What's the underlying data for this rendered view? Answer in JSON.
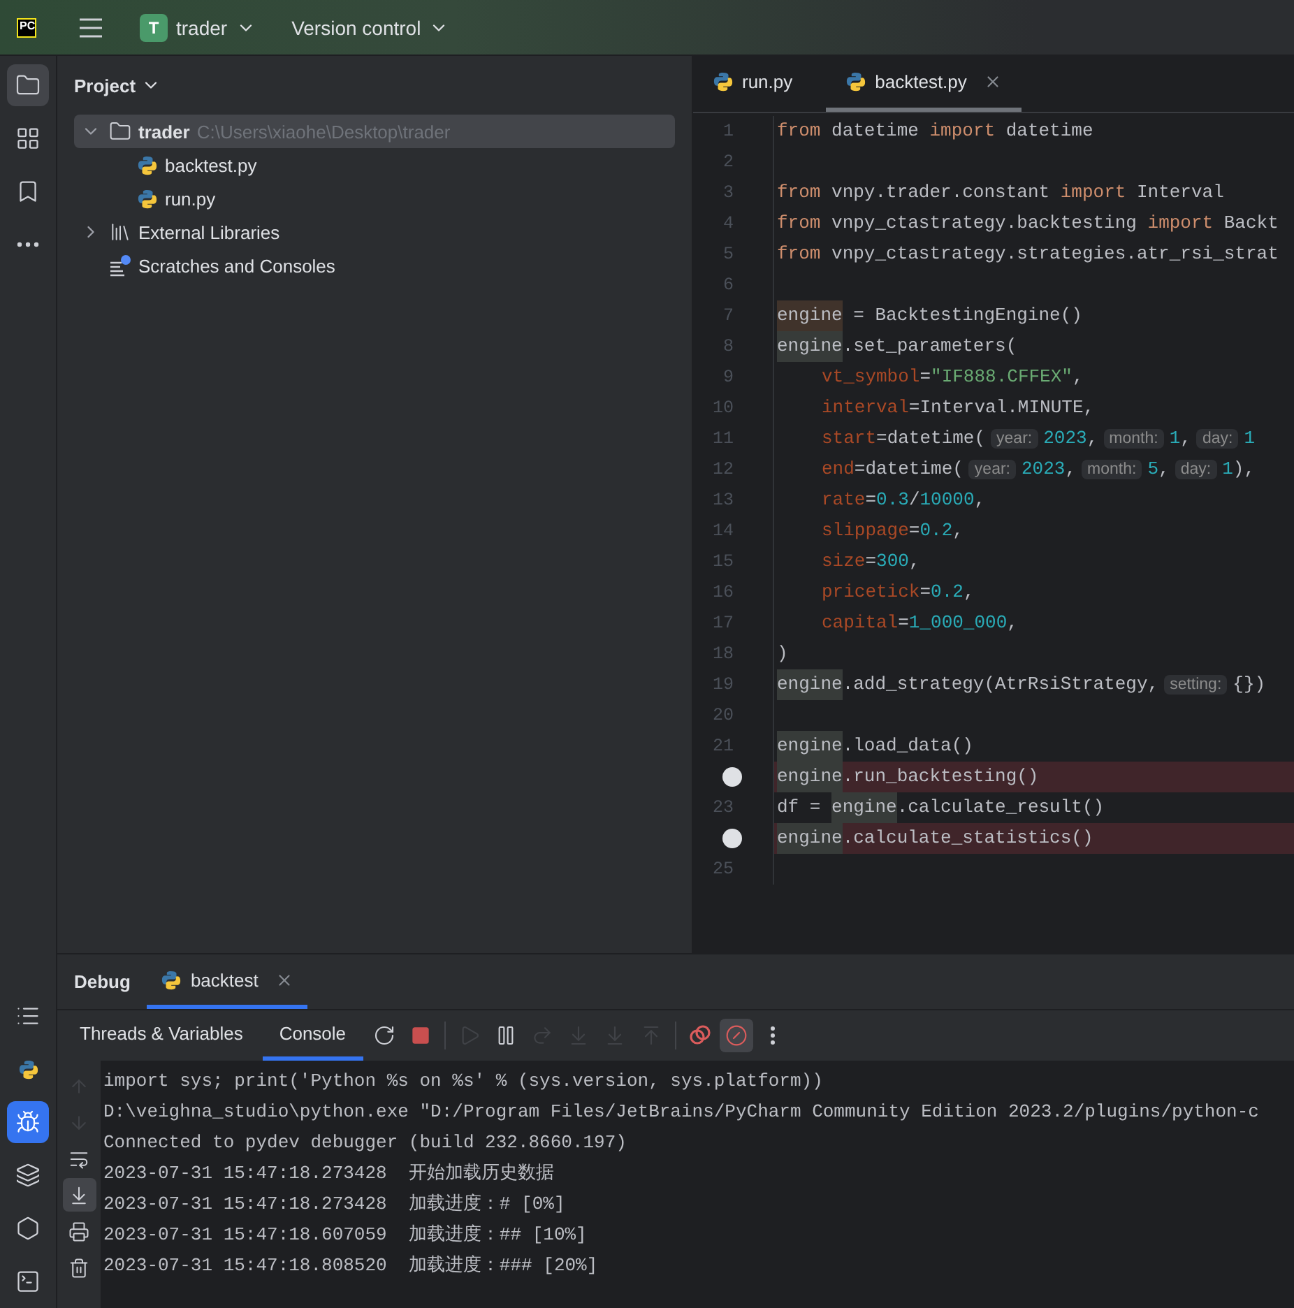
{
  "title_bar": {
    "logo": "PC",
    "project_badge": "T",
    "project": "trader",
    "vcs": "Version control"
  },
  "tool_strip": {
    "top": [
      {
        "kind": "project",
        "selected": true
      },
      {
        "kind": "structure",
        "selected": false
      },
      {
        "kind": "bookmarks",
        "selected": false
      },
      {
        "kind": "more",
        "selected": false
      }
    ],
    "bottom": [
      {
        "kind": "services",
        "selected": false
      },
      {
        "kind": "python_console",
        "selected": false
      },
      {
        "kind": "debug",
        "selected": true
      },
      {
        "kind": "packages",
        "selected": false
      },
      {
        "kind": "run",
        "selected": false
      },
      {
        "kind": "terminal",
        "selected": false
      }
    ]
  },
  "project_panel": {
    "title": "Project",
    "tree": [
      {
        "label": "trader",
        "path": "C:\\Users\\xiaohe\\Desktop\\trader",
        "kind": "folder",
        "expanded": true,
        "selected": true,
        "children": [
          {
            "label": "backtest.py",
            "kind": "python",
            "selected": false
          },
          {
            "label": "run.py",
            "kind": "python",
            "selected": false
          }
        ]
      },
      {
        "label": "External Libraries",
        "kind": "libraries",
        "expanded": false,
        "selected": false
      },
      {
        "label": "Scratches and Consoles",
        "kind": "scratches",
        "selected": false
      }
    ]
  },
  "editor": {
    "tabs": [
      {
        "label": "run.py",
        "selected": false
      },
      {
        "label": "backtest.py",
        "selected": true
      }
    ],
    "lines": [
      {
        "number": "1",
        "breakpoint": false,
        "indented": false,
        "tokens": [
          {
            "kind": "kw",
            "text": "from"
          },
          {
            "kind": "plain",
            "text": " datetime "
          },
          {
            "kind": "kw",
            "text": "import"
          },
          {
            "kind": "plain",
            "text": " datetime"
          }
        ]
      },
      {
        "number": "2",
        "breakpoint": false
      },
      {
        "number": "3",
        "breakpoint": false,
        "indented": false,
        "tokens": [
          {
            "kind": "kw",
            "text": "from"
          },
          {
            "kind": "plain",
            "text": " vnpy.trader.constant "
          },
          {
            "kind": "kw",
            "text": "import"
          },
          {
            "kind": "plain",
            "text": " Interval"
          }
        ]
      },
      {
        "number": "4",
        "breakpoint": false,
        "indented": false,
        "tokens": [
          {
            "kind": "kw",
            "text": "from"
          },
          {
            "kind": "plain",
            "text": " vnpy_ctastrategy.backtesting "
          },
          {
            "kind": "kw",
            "text": "import"
          },
          {
            "kind": "plain",
            "text": " Backt"
          }
        ]
      },
      {
        "number": "5",
        "breakpoint": false,
        "indented": false,
        "tokens": [
          {
            "kind": "kw",
            "text": "from"
          },
          {
            "kind": "plain",
            "text": " vnpy_ctastrategy.strategies.atr_rsi_strat"
          }
        ]
      },
      {
        "number": "6",
        "breakpoint": false
      },
      {
        "number": "7",
        "breakpoint": false,
        "indented": false,
        "tokens": [
          {
            "kind": "write",
            "text": "engine"
          },
          {
            "kind": "plain",
            "text": " = BacktestingEngine()"
          }
        ]
      },
      {
        "number": "8",
        "breakpoint": false,
        "indented": false,
        "tokens": [
          {
            "kind": "read",
            "text": "engine"
          },
          {
            "kind": "plain",
            "text": ".set_parameters("
          }
        ]
      },
      {
        "number": "9",
        "breakpoint": false,
        "indented": true,
        "tokens": [
          {
            "kind": "param",
            "text": "vt_symbol"
          },
          {
            "kind": "plain",
            "text": "="
          },
          {
            "kind": "str",
            "text": "\"IF888.CFFEX\""
          },
          {
            "kind": "plain",
            "text": ","
          }
        ]
      },
      {
        "number": "10",
        "breakpoint": false,
        "indented": true,
        "tokens": [
          {
            "kind": "param",
            "text": "interval"
          },
          {
            "kind": "plain",
            "text": "=Interval.MINUTE,"
          }
        ]
      },
      {
        "number": "11",
        "breakpoint": false,
        "indented": true,
        "tokens": [
          {
            "kind": "param",
            "text": "start"
          },
          {
            "kind": "plain",
            "text": "=datetime("
          },
          {
            "kind": "hint",
            "text": "year:"
          },
          {
            "kind": "num",
            "text": "2023"
          },
          {
            "kind": "plain",
            "text": ","
          },
          {
            "kind": "hint",
            "text": "month:"
          },
          {
            "kind": "num",
            "text": "1"
          },
          {
            "kind": "plain",
            "text": ","
          },
          {
            "kind": "hint",
            "text": "day:"
          },
          {
            "kind": "num",
            "text": "1"
          }
        ]
      },
      {
        "number": "12",
        "breakpoint": false,
        "indented": true,
        "tokens": [
          {
            "kind": "param",
            "text": "end"
          },
          {
            "kind": "plain",
            "text": "=datetime("
          },
          {
            "kind": "hint",
            "text": "year:"
          },
          {
            "kind": "num",
            "text": "2023"
          },
          {
            "kind": "plain",
            "text": ","
          },
          {
            "kind": "hint",
            "text": "month:"
          },
          {
            "kind": "num",
            "text": "5"
          },
          {
            "kind": "plain",
            "text": ","
          },
          {
            "kind": "hint",
            "text": "day:"
          },
          {
            "kind": "num",
            "text": "1"
          },
          {
            "kind": "plain",
            "text": "),"
          }
        ]
      },
      {
        "number": "13",
        "breakpoint": false,
        "indented": true,
        "tokens": [
          {
            "kind": "param",
            "text": "rate"
          },
          {
            "kind": "plain",
            "text": "="
          },
          {
            "kind": "num",
            "text": "0.3"
          },
          {
            "kind": "plain",
            "text": "/"
          },
          {
            "kind": "num",
            "text": "10000"
          },
          {
            "kind": "plain",
            "text": ","
          }
        ]
      },
      {
        "number": "14",
        "breakpoint": false,
        "indented": true,
        "tokens": [
          {
            "kind": "param",
            "text": "slippage"
          },
          {
            "kind": "plain",
            "text": "="
          },
          {
            "kind": "num",
            "text": "0.2"
          },
          {
            "kind": "plain",
            "text": ","
          }
        ]
      },
      {
        "number": "15",
        "breakpoint": false,
        "indented": true,
        "tokens": [
          {
            "kind": "param",
            "text": "size"
          },
          {
            "kind": "plain",
            "text": "="
          },
          {
            "kind": "num",
            "text": "300"
          },
          {
            "kind": "plain",
            "text": ","
          }
        ]
      },
      {
        "number": "16",
        "breakpoint": false,
        "indented": true,
        "tokens": [
          {
            "kind": "param",
            "text": "pricetick"
          },
          {
            "kind": "plain",
            "text": "="
          },
          {
            "kind": "num",
            "text": "0.2"
          },
          {
            "kind": "plain",
            "text": ","
          }
        ]
      },
      {
        "number": "17",
        "breakpoint": false,
        "indented": true,
        "tokens": [
          {
            "kind": "param",
            "text": "capital"
          },
          {
            "kind": "plain",
            "text": "="
          },
          {
            "kind": "num",
            "text": "1_000_000"
          },
          {
            "kind": "plain",
            "text": ","
          }
        ]
      },
      {
        "number": "18",
        "breakpoint": false,
        "indented": false,
        "tokens": [
          {
            "kind": "plain",
            "text": ")"
          }
        ]
      },
      {
        "number": "19",
        "breakpoint": false,
        "indented": false,
        "tokens": [
          {
            "kind": "read",
            "text": "engine"
          },
          {
            "kind": "plain",
            "text": ".add_strategy(AtrRsiStrategy,"
          },
          {
            "kind": "hint",
            "text": "setting:"
          },
          {
            "kind": "plain",
            "text": "{})"
          }
        ]
      },
      {
        "number": "20",
        "breakpoint": false
      },
      {
        "number": "21",
        "breakpoint": false,
        "indented": false,
        "tokens": [
          {
            "kind": "read",
            "text": "engine"
          },
          {
            "kind": "plain",
            "text": ".load_data()"
          }
        ]
      },
      {
        "breakpoint": true,
        "indented": false,
        "tokens": [
          {
            "kind": "read",
            "text": "engine"
          },
          {
            "kind": "plain",
            "text": ".run_backtesting()"
          }
        ]
      },
      {
        "number": "23",
        "breakpoint": false,
        "indented": false,
        "tokens": [
          {
            "kind": "plain",
            "text": "df = "
          },
          {
            "kind": "read",
            "text": "engine"
          },
          {
            "kind": "plain",
            "text": ".calculate_result()"
          }
        ]
      },
      {
        "breakpoint": true,
        "indented": false,
        "tokens": [
          {
            "kind": "read",
            "text": "engine"
          },
          {
            "kind": "plain",
            "text": ".calculate_statistics()"
          }
        ]
      },
      {
        "number": "25",
        "breakpoint": false
      }
    ]
  },
  "debug_panel": {
    "title": "Debug",
    "tabs": [
      {
        "label": "backtest",
        "selected": true
      }
    ],
    "subtabs": [
      {
        "label": "Threads & Variables",
        "selected": false
      },
      {
        "label": "Console",
        "selected": true
      }
    ],
    "toolbar": [
      {
        "kind": "rerun",
        "disabled": false
      },
      {
        "kind": "stop",
        "disabled": false
      },
      {
        "kind": "resume",
        "disabled": true
      },
      {
        "kind": "pause",
        "disabled": false
      },
      {
        "kind": "step_over",
        "disabled": true
      },
      {
        "kind": "step_into",
        "disabled": true
      },
      {
        "kind": "step_into_my",
        "disabled": true
      },
      {
        "kind": "step_out",
        "disabled": true
      },
      {
        "kind": "breakpoints",
        "disabled": false
      },
      {
        "kind": "mute",
        "disabled": false,
        "selected": true
      },
      {
        "kind": "more",
        "disabled": false
      }
    ],
    "gutter": [
      {
        "kind": "up",
        "disabled": true
      },
      {
        "kind": "down",
        "disabled": true
      },
      {
        "kind": "wrap",
        "disabled": false,
        "selected": false
      },
      {
        "kind": "scroll_end",
        "disabled": false,
        "selected": true
      },
      {
        "kind": "print",
        "disabled": false
      },
      {
        "kind": "clear",
        "disabled": false
      }
    ],
    "console": [
      "import sys; print('Python %s on %s' % (sys.version, sys.platform))",
      "D:\\veighna_studio\\python.exe \"D:/Program Files/JetBrains/PyCharm Community Edition 2023.2/plugins/python-c",
      "Connected to pydev debugger (build 232.8660.197)",
      "2023-07-31 15:47:18.273428  开始加载历史数据",
      "2023-07-31 15:47:18.273428  加载进度：# [0%]",
      "2023-07-31 15:47:18.607059  加载进度：## [10%]",
      "2023-07-31 15:47:18.808520  加载进度：### [20%]"
    ]
  }
}
